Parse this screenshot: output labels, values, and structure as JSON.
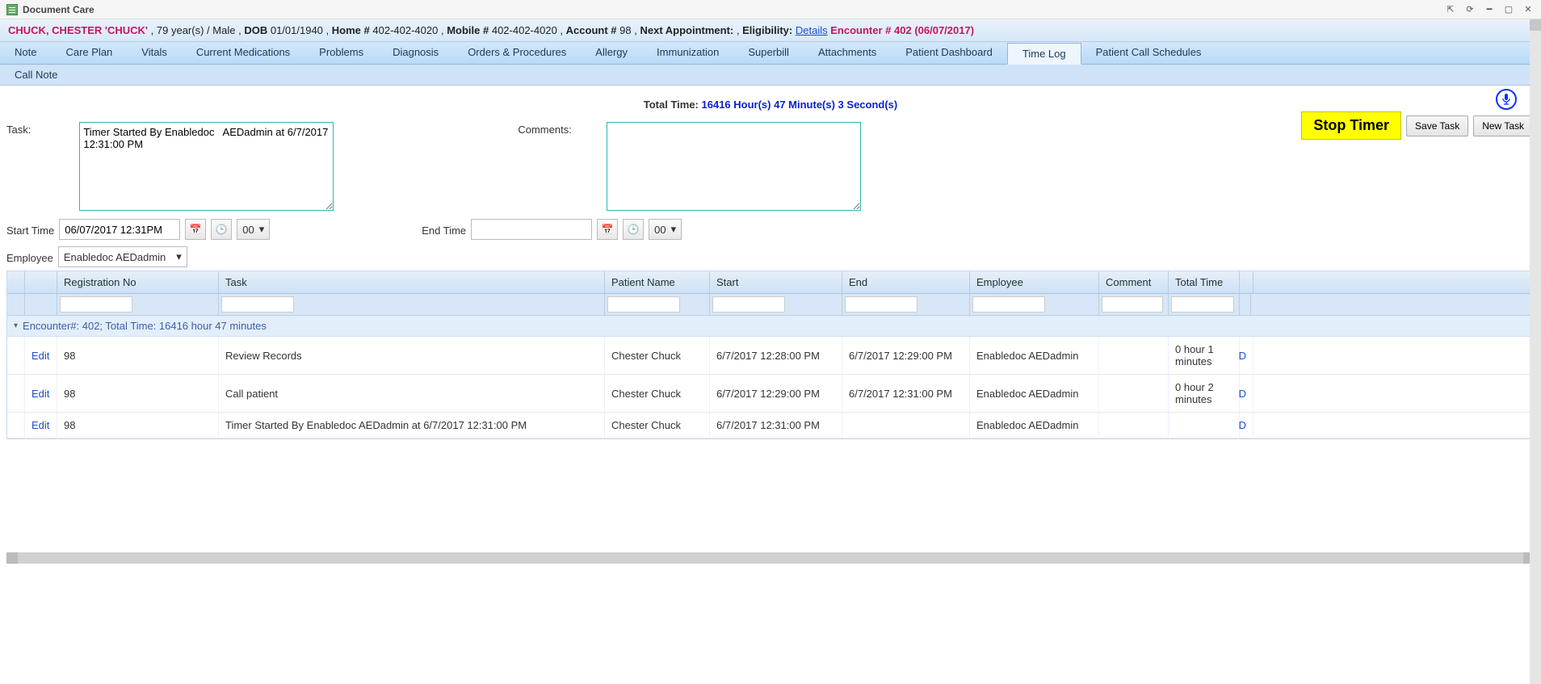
{
  "window": {
    "title": "Document Care"
  },
  "patient": {
    "name": "CHUCK, CHESTER 'CHUCK'",
    "age": "79 year(s)",
    "gender": "Male",
    "dob_label": "DOB",
    "dob": "01/01/1940",
    "home_label": "Home #",
    "home": "402-402-4020",
    "mobile_label": "Mobile #",
    "mobile": "402-402-4020",
    "account_label": "Account #",
    "account": "98",
    "na_label": "Next Appointment:",
    "na_value": "",
    "elig_label": "Eligibility:",
    "elig_link": "Details",
    "encounter_label": "Encounter # 402",
    "encounter_date": "(06/07/2017)"
  },
  "tabs": {
    "items": [
      "Note",
      "Care Plan",
      "Vitals",
      "Current Medications",
      "Problems",
      "Diagnosis",
      "Orders & Procedures",
      "Allergy",
      "Immunization",
      "Superbill",
      "Attachments",
      "Patient Dashboard",
      "Time Log",
      "Patient Call Schedules"
    ],
    "active": "Time Log",
    "row2": [
      "Call Note"
    ]
  },
  "timelog": {
    "total_label": "Total Time:",
    "total_value": "16416 Hour(s) 47 Minute(s) 3 Second(s)",
    "stop_label": "Stop Timer",
    "save_label": "Save Task",
    "new_label": "New Task",
    "task_label": "Task:",
    "task_text": "Timer Started By Enabledoc   AEDadmin at 6/7/2017 12:31:00 PM",
    "comments_label": "Comments:",
    "start_label": "Start Time",
    "start_value": "06/07/2017 12:31PM",
    "end_label": "End Time",
    "end_value": "",
    "sec_sel": "00",
    "employee_label": "Employee",
    "employee_value": "Enabledoc AEDadmin"
  },
  "grid": {
    "headers": {
      "reg": "Registration No",
      "task": "Task",
      "pat": "Patient Name",
      "start": "Start",
      "end": "End",
      "emp": "Employee",
      "com": "Comment",
      "tot": "Total Time"
    },
    "group_label": "Encounter#: 402; Total Time: 16416 hour 47 minutes",
    "edit_label": "Edit",
    "d_label": "D",
    "rows": [
      {
        "reg": "98",
        "task": "Review Records",
        "pat": "Chester Chuck",
        "start": "6/7/2017 12:28:00 PM",
        "end": "6/7/2017 12:29:00 PM",
        "emp": "Enabledoc AEDadmin",
        "com": "",
        "tot": "0 hour 1 minutes"
      },
      {
        "reg": "98",
        "task": "Call patient",
        "pat": "Chester Chuck",
        "start": "6/7/2017 12:29:00 PM",
        "end": "6/7/2017 12:31:00 PM",
        "emp": "Enabledoc AEDadmin",
        "com": "",
        "tot": "0 hour 2 minutes"
      },
      {
        "reg": "98",
        "task": "Timer Started By Enabledoc AEDadmin at 6/7/2017 12:31:00 PM",
        "pat": "Chester Chuck",
        "start": "6/7/2017 12:31:00 PM",
        "end": "",
        "emp": "Enabledoc AEDadmin",
        "com": "",
        "tot": ""
      }
    ]
  }
}
